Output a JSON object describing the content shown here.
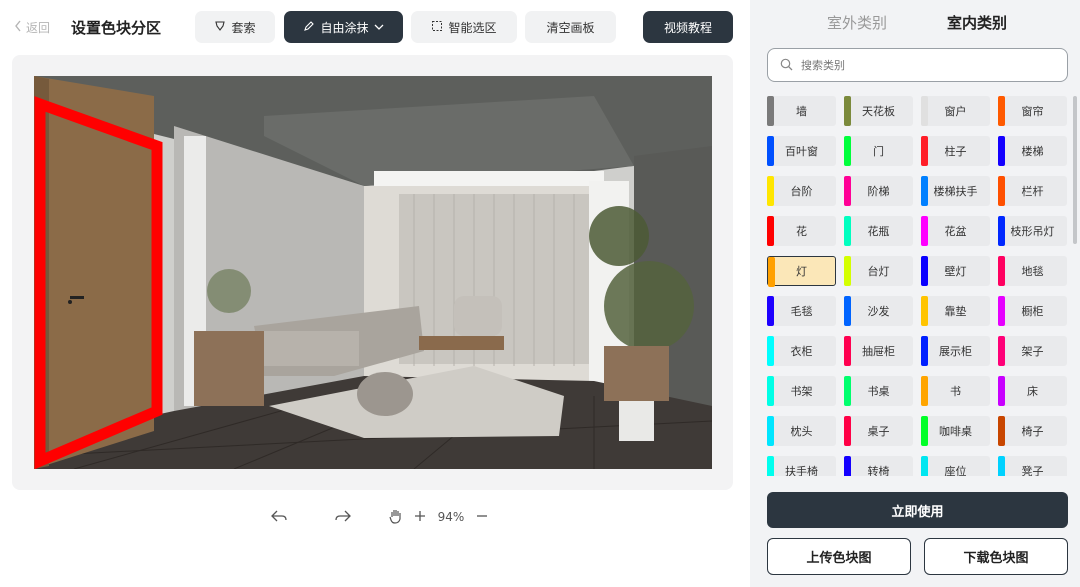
{
  "header": {
    "back_label": "返回",
    "title": "设置色块分区"
  },
  "toolbar": {
    "lasso_label": "套索",
    "paint_label": "自由涂抹",
    "smart_label": "智能选区",
    "clear_label": "清空画板",
    "video_label": "视频教程"
  },
  "canvas": {
    "zoom": "94%"
  },
  "panel": {
    "tabs": [
      {
        "label": "室外类别",
        "active": false
      },
      {
        "label": "室内类别",
        "active": true
      }
    ],
    "search_placeholder": "搜索类别",
    "categories": [
      {
        "label": "墙",
        "color": "#7a7a7a"
      },
      {
        "label": "天花板",
        "color": "#7b8a3c"
      },
      {
        "label": "窗户",
        "color": "#e0e0e0"
      },
      {
        "label": "窗帘",
        "color": "#ff5a00"
      },
      {
        "label": "百叶窗",
        "color": "#0050ff"
      },
      {
        "label": "门",
        "color": "#00ff3c"
      },
      {
        "label": "柱子",
        "color": "#ff1e28"
      },
      {
        "label": "楼梯",
        "color": "#1400ff"
      },
      {
        "label": "台阶",
        "color": "#ffe600"
      },
      {
        "label": "阶梯",
        "color": "#ff0096"
      },
      {
        "label": "楼梯扶手",
        "color": "#0080ff"
      },
      {
        "label": "栏杆",
        "color": "#ff5000"
      },
      {
        "label": "花",
        "color": "#ff0000"
      },
      {
        "label": "花瓶",
        "color": "#00ffc0"
      },
      {
        "label": "花盆",
        "color": "#ff00ff"
      },
      {
        "label": "枝形吊灯",
        "color": "#0028ff"
      },
      {
        "label": "灯",
        "color": "#ffa000"
      },
      {
        "label": "台灯",
        "color": "#d4ff00"
      },
      {
        "label": "壁灯",
        "color": "#0a00ff"
      },
      {
        "label": "地毯",
        "color": "#ff0060"
      },
      {
        "label": "毛毯",
        "color": "#1e00ff"
      },
      {
        "label": "沙发",
        "color": "#0064ff"
      },
      {
        "label": "靠垫",
        "color": "#ffc400"
      },
      {
        "label": "橱柜",
        "color": "#e600ff"
      },
      {
        "label": "衣柜",
        "color": "#00ffff"
      },
      {
        "label": "抽屉柜",
        "color": "#ff0050"
      },
      {
        "label": "展示柜",
        "color": "#0020ff"
      },
      {
        "label": "架子",
        "color": "#ff0078"
      },
      {
        "label": "书架",
        "color": "#00ffe6"
      },
      {
        "label": "书桌",
        "color": "#00ff6e"
      },
      {
        "label": "书",
        "color": "#ffa500"
      },
      {
        "label": "床",
        "color": "#c800ff"
      },
      {
        "label": "枕头",
        "color": "#00e6ff"
      },
      {
        "label": "桌子",
        "color": "#ff0046"
      },
      {
        "label": "咖啡桌",
        "color": "#00ff28"
      },
      {
        "label": "椅子",
        "color": "#c84600"
      },
      {
        "label": "扶手椅",
        "color": "#00ffee"
      },
      {
        "label": "转椅",
        "color": "#1400ff"
      },
      {
        "label": "座位",
        "color": "#00e6f0"
      },
      {
        "label": "凳子",
        "color": "#00d2ff"
      }
    ],
    "selected_index": 16,
    "use_button": "立即使用",
    "upload_button": "上传色块图",
    "download_button": "下载色块图"
  },
  "colors": {
    "dark": "#2c3640",
    "selection_outline": "#ff0000"
  }
}
